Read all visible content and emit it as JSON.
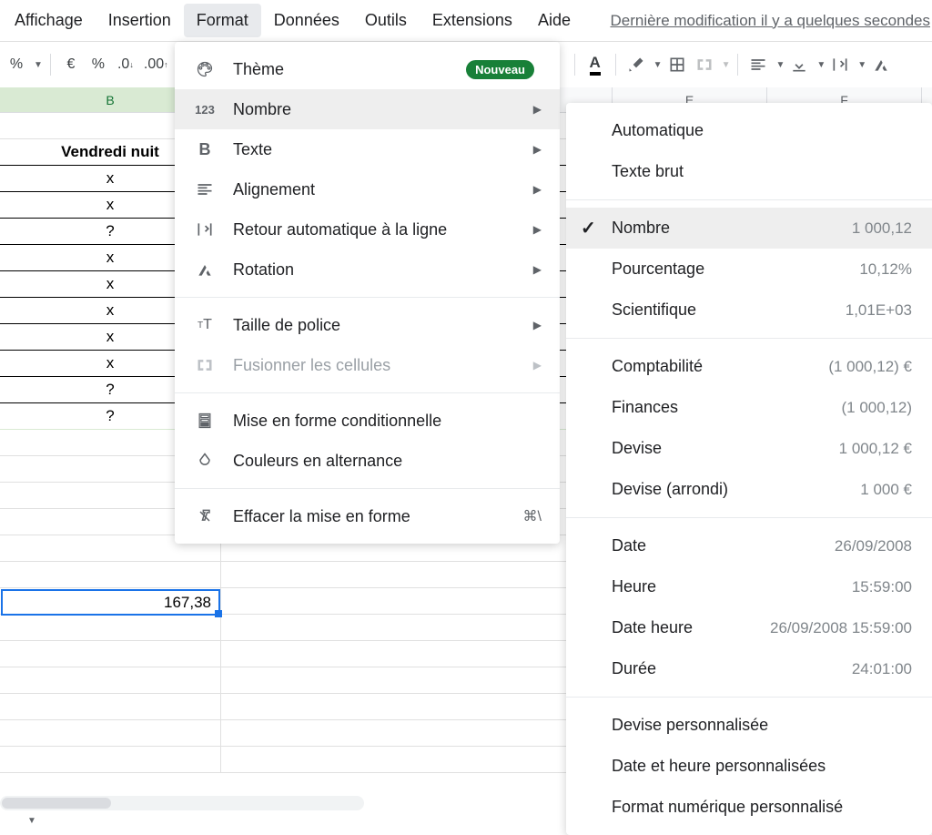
{
  "menubar": {
    "items": [
      "Affichage",
      "Insertion",
      "Format",
      "Données",
      "Outils",
      "Extensions",
      "Aide"
    ],
    "active_index": 2,
    "last_edit": "Dernière modification il y a quelques secondes"
  },
  "toolbar": {
    "percent": "%",
    "euro": "€",
    "percent2": "%",
    "dec_dec": ".0",
    "dec_inc": ".00"
  },
  "columns": {
    "b": "B",
    "e": "E",
    "f": "F"
  },
  "grid": {
    "header": "Vendredi nuit",
    "rows": [
      "x",
      "x",
      "?",
      "x",
      "x",
      "x",
      "x",
      "x",
      "?",
      "?"
    ],
    "selected_value": "167,38"
  },
  "format_menu": {
    "items": [
      {
        "icon": "palette",
        "label": "Thème",
        "badge": "Nouveau"
      },
      {
        "icon": "123",
        "label": "Nombre",
        "arrow": true,
        "hovered": true
      },
      {
        "icon": "bold",
        "label": "Texte",
        "arrow": true
      },
      {
        "icon": "align",
        "label": "Alignement",
        "arrow": true
      },
      {
        "icon": "wrap",
        "label": "Retour automatique à la ligne",
        "arrow": true
      },
      {
        "icon": "rotate",
        "label": "Rotation",
        "arrow": true
      },
      {
        "sep": true
      },
      {
        "icon": "fontsize",
        "label": "Taille de police",
        "arrow": true
      },
      {
        "icon": "merge",
        "label": "Fusionner les cellules",
        "arrow": true,
        "disabled": true
      },
      {
        "sep": true
      },
      {
        "icon": "condformat",
        "label": "Mise en forme conditionnelle"
      },
      {
        "icon": "altcolors",
        "label": "Couleurs en alternance"
      },
      {
        "sep": true
      },
      {
        "icon": "clear",
        "label": "Effacer la mise en forme",
        "shortcut": "⌘\\"
      }
    ]
  },
  "number_menu": {
    "groups": [
      [
        {
          "label": "Automatique"
        },
        {
          "label": "Texte brut"
        }
      ],
      [
        {
          "label": "Nombre",
          "example": "1 000,12",
          "checked": true,
          "hovered": true
        },
        {
          "label": "Pourcentage",
          "example": "10,12%"
        },
        {
          "label": "Scientifique",
          "example": "1,01E+03"
        }
      ],
      [
        {
          "label": "Comptabilité",
          "example": "(1 000,12) €"
        },
        {
          "label": "Finances",
          "example": "(1 000,12)"
        },
        {
          "label": "Devise",
          "example": "1 000,12 €"
        },
        {
          "label": "Devise (arrondi)",
          "example": "1 000 €"
        }
      ],
      [
        {
          "label": "Date",
          "example": "26/09/2008"
        },
        {
          "label": "Heure",
          "example": "15:59:00"
        },
        {
          "label": "Date heure",
          "example": "26/09/2008 15:59:00"
        },
        {
          "label": "Durée",
          "example": "24:01:00"
        }
      ],
      [
        {
          "label": "Devise personnalisée"
        },
        {
          "label": "Date et heure personnalisées"
        },
        {
          "label": "Format numérique personnalisé"
        }
      ]
    ]
  }
}
